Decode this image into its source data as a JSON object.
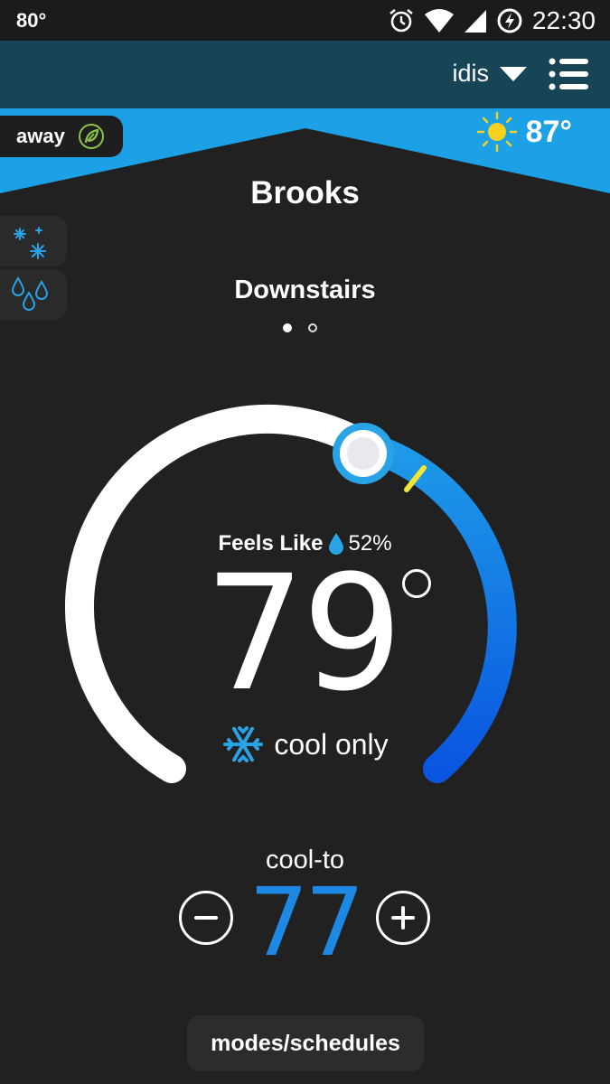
{
  "status_bar": {
    "left_text": "80°",
    "time": "22:30",
    "icons": [
      "alarm-icon",
      "wifi-icon",
      "signal-icon",
      "battery-charging-icon"
    ]
  },
  "header": {
    "account_name": "idis",
    "icons": [
      "dropdown-icon",
      "menu-icon"
    ]
  },
  "away": {
    "label": "away",
    "icon": "leaf-icon"
  },
  "weather": {
    "temperature": "87°",
    "icon": "sun-icon"
  },
  "location": {
    "name": "Brooks"
  },
  "side_buttons": [
    {
      "name": "fan-snow-button",
      "icon": "snowflakes-icon"
    },
    {
      "name": "humidity-button",
      "icon": "droplets-icon"
    }
  ],
  "zone": {
    "name": "Downstairs",
    "page_index": 0,
    "page_count": 2
  },
  "dial": {
    "feels_like_label": "Feels Like",
    "humidity": "52%",
    "current_temp": "79",
    "mode_label": "cool only",
    "colors": {
      "track": "#ffffff",
      "cool_start": "#1e9be8",
      "cool_end": "#0a56e0",
      "marker": "#f2e534",
      "thumb": "#2aa3e6"
    }
  },
  "setpoint": {
    "label": "cool-to",
    "value": "77",
    "color": "#1e88e5"
  },
  "footer": {
    "modes_button": "modes/schedules"
  },
  "colors": {
    "background": "#212121",
    "app_bar": "#174556",
    "band": "#1da1e6"
  }
}
